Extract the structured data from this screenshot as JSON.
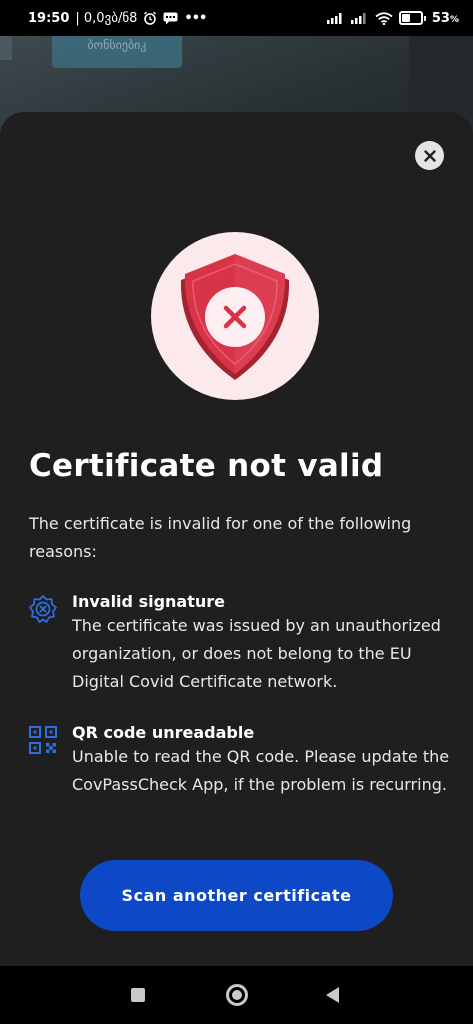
{
  "status_bar": {
    "time": "19:50",
    "date": "| 0,0ვბ/ნ8",
    "alarm_icon": "alarm-clock-icon",
    "message_icon": "chat-bubble-icon",
    "more": "•••",
    "battery_percent": "53",
    "battery_unit": "%",
    "battery_level": 0.53
  },
  "camera_backdrop": {
    "sticker_text": "ბონსიებიკ"
  },
  "dialog": {
    "close_icon": "close-icon",
    "hero_icon": "shield-error-icon",
    "title": "Certificate not valid",
    "intro": "The certificate is invalid for one of the following reasons:",
    "reasons": [
      {
        "icon": "badge-x-icon",
        "title": "Invalid signature",
        "description": "The certificate was issued by an unauthorized organization, or does not belong to the EU Digital Covid Certificate network."
      },
      {
        "icon": "qr-code-icon",
        "title": "QR code unreadable",
        "description": "Unable to read the QR code. Please update the CovPassCheck App, if the problem is recurring."
      }
    ],
    "primary_button": "Scan another certificate"
  },
  "colors": {
    "sheet_background": "#1f1f1f",
    "accent_blue": "#0d48c7",
    "error_red": "#d83447",
    "hero_circle": "#fbe9ec",
    "icon_blue": "#2d6fe0"
  },
  "nav_bar": {
    "recents_icon": "square-icon",
    "home_icon": "circle-icon",
    "back_icon": "triangle-back-icon"
  }
}
